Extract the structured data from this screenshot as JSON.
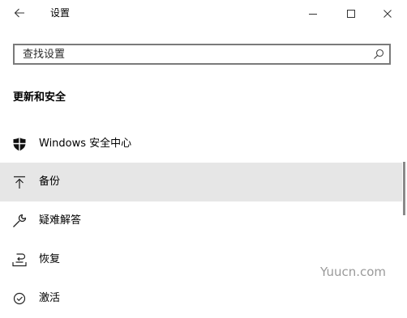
{
  "window": {
    "title": "设置",
    "back_icon": "arrow-left-icon",
    "minimize_icon": "minimize-icon",
    "maximize_icon": "maximize-icon",
    "close_icon": "close-icon"
  },
  "search": {
    "value": "",
    "placeholder": "查找设置",
    "icon": "search-icon"
  },
  "section": {
    "title": "更新和安全"
  },
  "nav_items": [
    {
      "label": "Windows 安全中心",
      "icon": "shield-icon",
      "selected": false
    },
    {
      "label": "备份",
      "icon": "backup-arrow-icon",
      "selected": true
    },
    {
      "label": "疑难解答",
      "icon": "wrench-icon",
      "selected": false
    },
    {
      "label": "恢复",
      "icon": "recovery-icon",
      "selected": false
    },
    {
      "label": "激活",
      "icon": "activation-icon",
      "selected": false
    }
  ],
  "watermark": {
    "text": "Yuucn.com"
  },
  "colors": {
    "background": "#ffffff",
    "selected_row": "#e6e6e6",
    "search_border": "#7a7a7a",
    "scrollbar": "#8a8a8a",
    "watermark": "#9a9a9a"
  }
}
